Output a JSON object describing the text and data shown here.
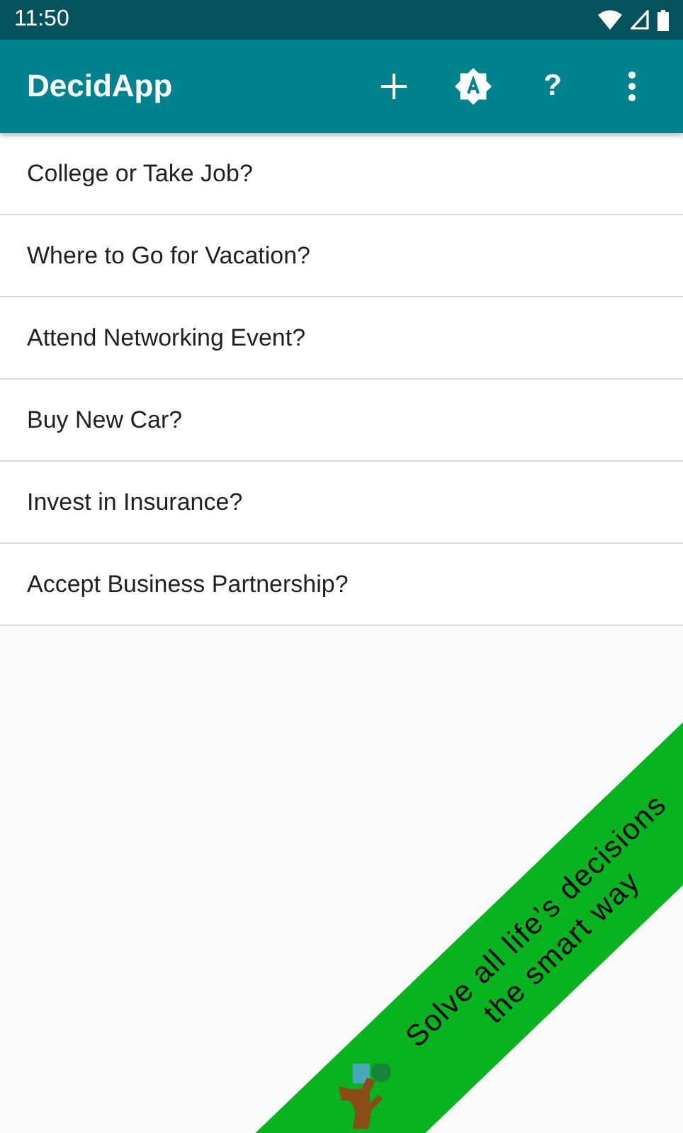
{
  "status_bar": {
    "time": "11:50"
  },
  "app_bar": {
    "title": "DecidApp",
    "actions": [
      {
        "kind": "add"
      },
      {
        "kind": "theme"
      },
      {
        "kind": "help",
        "label": "?"
      },
      {
        "kind": "more"
      }
    ]
  },
  "decisions": [
    {
      "title": "College or Take Job?"
    },
    {
      "title": "Where to Go for Vacation?"
    },
    {
      "title": "Attend Networking Event?"
    },
    {
      "title": "Buy New Car?"
    },
    {
      "title": "Invest in Insurance?"
    },
    {
      "title": "Accept Business Partnership?"
    }
  ],
  "banner": {
    "lines": [
      "Solve all life’s decisions",
      "the smart way"
    ]
  }
}
